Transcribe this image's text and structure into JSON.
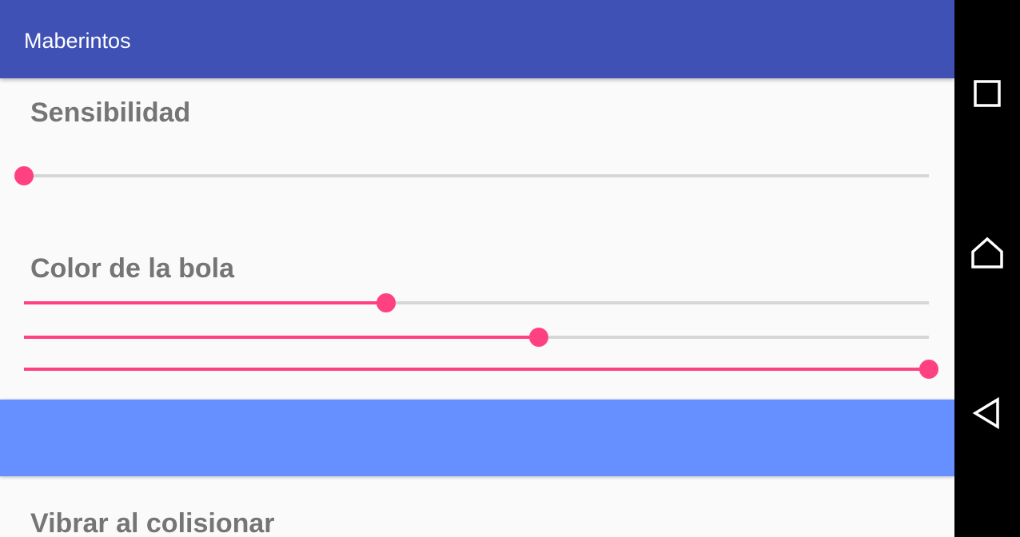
{
  "app": {
    "title": "Maberintos"
  },
  "sensitivity": {
    "label": "Sensibilidad",
    "value": 0.0
  },
  "ball_color": {
    "label": "Color de la bola",
    "sliders": [
      {
        "name": "red",
        "value": 0.4
      },
      {
        "name": "green",
        "value": 0.569
      },
      {
        "name": "blue",
        "value": 1.0
      }
    ],
    "preview_color": "#668fff"
  },
  "vibration": {
    "label": "Vibrar al colisionar"
  },
  "colors": {
    "app_bar": "#3f51b5",
    "accent": "#ff4081",
    "track": "#d6d6d6",
    "label_text": "#757575",
    "background": "#fafafa"
  },
  "navbar": {
    "buttons": [
      "recents-icon",
      "home-icon",
      "back-icon"
    ]
  }
}
